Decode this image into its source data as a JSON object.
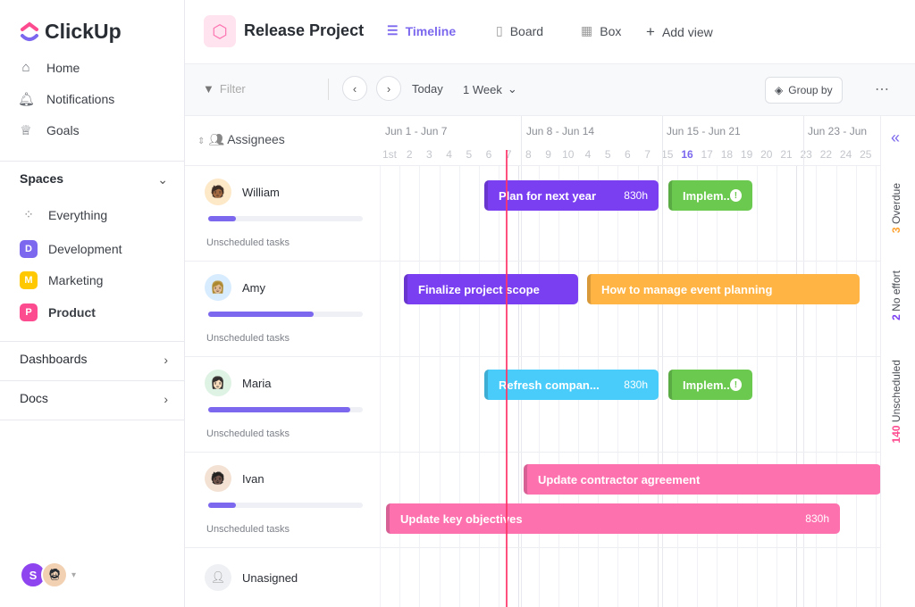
{
  "app": {
    "name": "ClickUp"
  },
  "sidebar": {
    "nav": [
      {
        "label": "Home",
        "icon": "home-icon"
      },
      {
        "label": "Notifications",
        "icon": "bell-icon"
      },
      {
        "label": "Goals",
        "icon": "trophy-icon"
      }
    ],
    "spaces_label": "Spaces",
    "everything": "Everything",
    "spaces": [
      {
        "letter": "D",
        "label": "Development",
        "color": "#7b68ee"
      },
      {
        "letter": "M",
        "label": "Marketing",
        "color": "#ffc800"
      },
      {
        "letter": "P",
        "label": "Product",
        "color": "#fd4b8f"
      }
    ],
    "dashboards": "Dashboards",
    "docs": "Docs",
    "user_initial": "S"
  },
  "header": {
    "project": "Release Project",
    "views": [
      {
        "label": "Timeline",
        "active": true
      },
      {
        "label": "Board"
      },
      {
        "label": "Box"
      },
      {
        "label": "Add view"
      }
    ]
  },
  "toolbar": {
    "filter": "Filter",
    "today": "Today",
    "range": "1 Week",
    "group_by": "Group by"
  },
  "timeline": {
    "assignees_label": "Assignees",
    "weeks": [
      "Jun 1 - Jun 7",
      "Jun 8 - Jun 14",
      "Jun 15 - Jun 21",
      "Jun 23 - Jun"
    ],
    "days": [
      "1st",
      "2",
      "3",
      "4",
      "5",
      "6",
      "7",
      "8",
      "9",
      "10",
      "4",
      "5",
      "6",
      "7",
      "15",
      "16",
      "17",
      "18",
      "19",
      "20",
      "21",
      "23",
      "22",
      "24",
      "25",
      "2"
    ],
    "today_day": "16",
    "rows": [
      {
        "name": "William",
        "progress": 0.18,
        "unscheduled": "Unscheduled tasks"
      },
      {
        "name": "Amy",
        "progress": 0.68,
        "unscheduled": "Unscheduled tasks"
      },
      {
        "name": "Maria",
        "progress": 0.92,
        "unscheduled": "Unscheduled tasks"
      },
      {
        "name": "Ivan",
        "progress": 0.18,
        "unscheduled": "Unscheduled tasks"
      }
    ],
    "unassigned": "Unasigned",
    "tasks": [
      {
        "label": "Plan for next year",
        "hours": "830h",
        "color": "#7b3ff2"
      },
      {
        "label": "Implem..",
        "color": "#6bc950",
        "alert": true
      },
      {
        "label": "Finalize project scope",
        "color": "#7b3ff2"
      },
      {
        "label": "How to manage event planning",
        "color": "#ffb443"
      },
      {
        "label": "Refresh compan...",
        "hours": "830h",
        "color": "#49ccf9"
      },
      {
        "label": "Implem..",
        "color": "#6bc950",
        "alert": true
      },
      {
        "label": "Update contractor agreement",
        "color": "#fd71af"
      },
      {
        "label": "Update key objectives",
        "hours": "830h",
        "color": "#fd71af"
      }
    ]
  },
  "side_panel": {
    "overdue_count": "3",
    "overdue": "Overdue",
    "noeffort_count": "2",
    "noeffort": "No effort",
    "unscheduled_count": "140",
    "unscheduled": "Unscheduled"
  }
}
